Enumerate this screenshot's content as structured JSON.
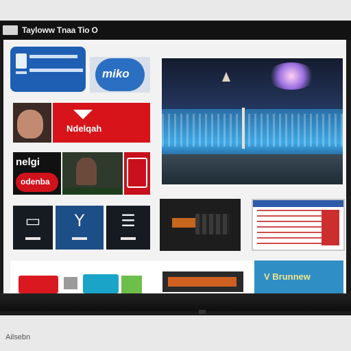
{
  "window": {
    "title": "Tayloww Tnaa Tio O"
  },
  "tiles": {
    "miko_label": "miko",
    "red_banner_label": "Ndelqah",
    "nelgi_label": "nelgi",
    "nelgi_pill_label": "odenba",
    "promo_label": "V Brunnew"
  },
  "footer": {
    "brand": "Ailsebn"
  },
  "icons": {
    "app_1": "tv-icon",
    "app_2": "antenna-icon",
    "app_3": "menu-icon"
  },
  "colors": {
    "accent_blue": "#1f5fb3",
    "accent_red": "#d7141a",
    "teal": "#1aa4c7",
    "frame": "#121212"
  }
}
